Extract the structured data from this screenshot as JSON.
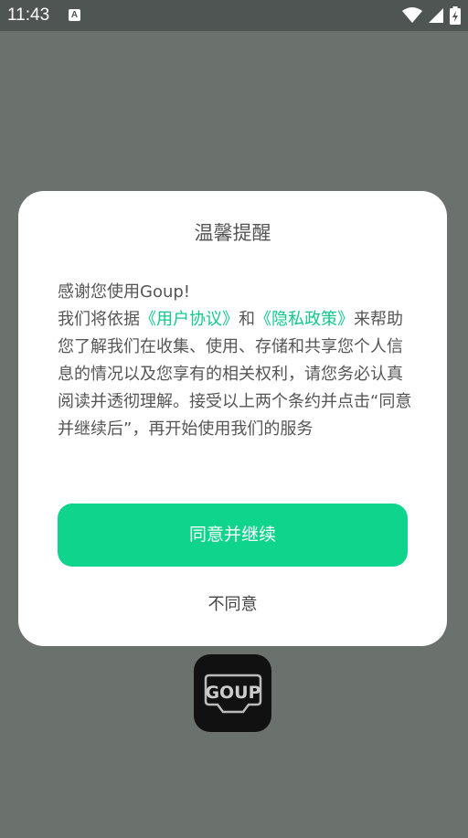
{
  "status_bar": {
    "time": "11:43",
    "notification_icon": "a-icon",
    "icons": [
      "wifi-icon",
      "signal-icon",
      "battery-charging-icon"
    ]
  },
  "dialog": {
    "title": "温馨提醒",
    "greeting": "感谢您使用Goup!",
    "body_prefix": "我们将依据",
    "user_agreement_link": "《用户协议》",
    "conjunction": "和",
    "privacy_policy_link": "《隐私政策》",
    "body_suffix": "来帮助您了解我们在收集、使用、存储和共享您个人信息的情况以及您享有的相关权利，请您务必认真阅读并透彻理解。接受以上两个条约并点击“同意并继续后”，再开始使用我们的服务",
    "agree_label": "同意并继续",
    "disagree_label": "不同意"
  },
  "app": {
    "logo_text": "GOUP"
  },
  "colors": {
    "accent": "#0fd48c",
    "link": "#12c98b",
    "overlay": "#6b716d"
  }
}
